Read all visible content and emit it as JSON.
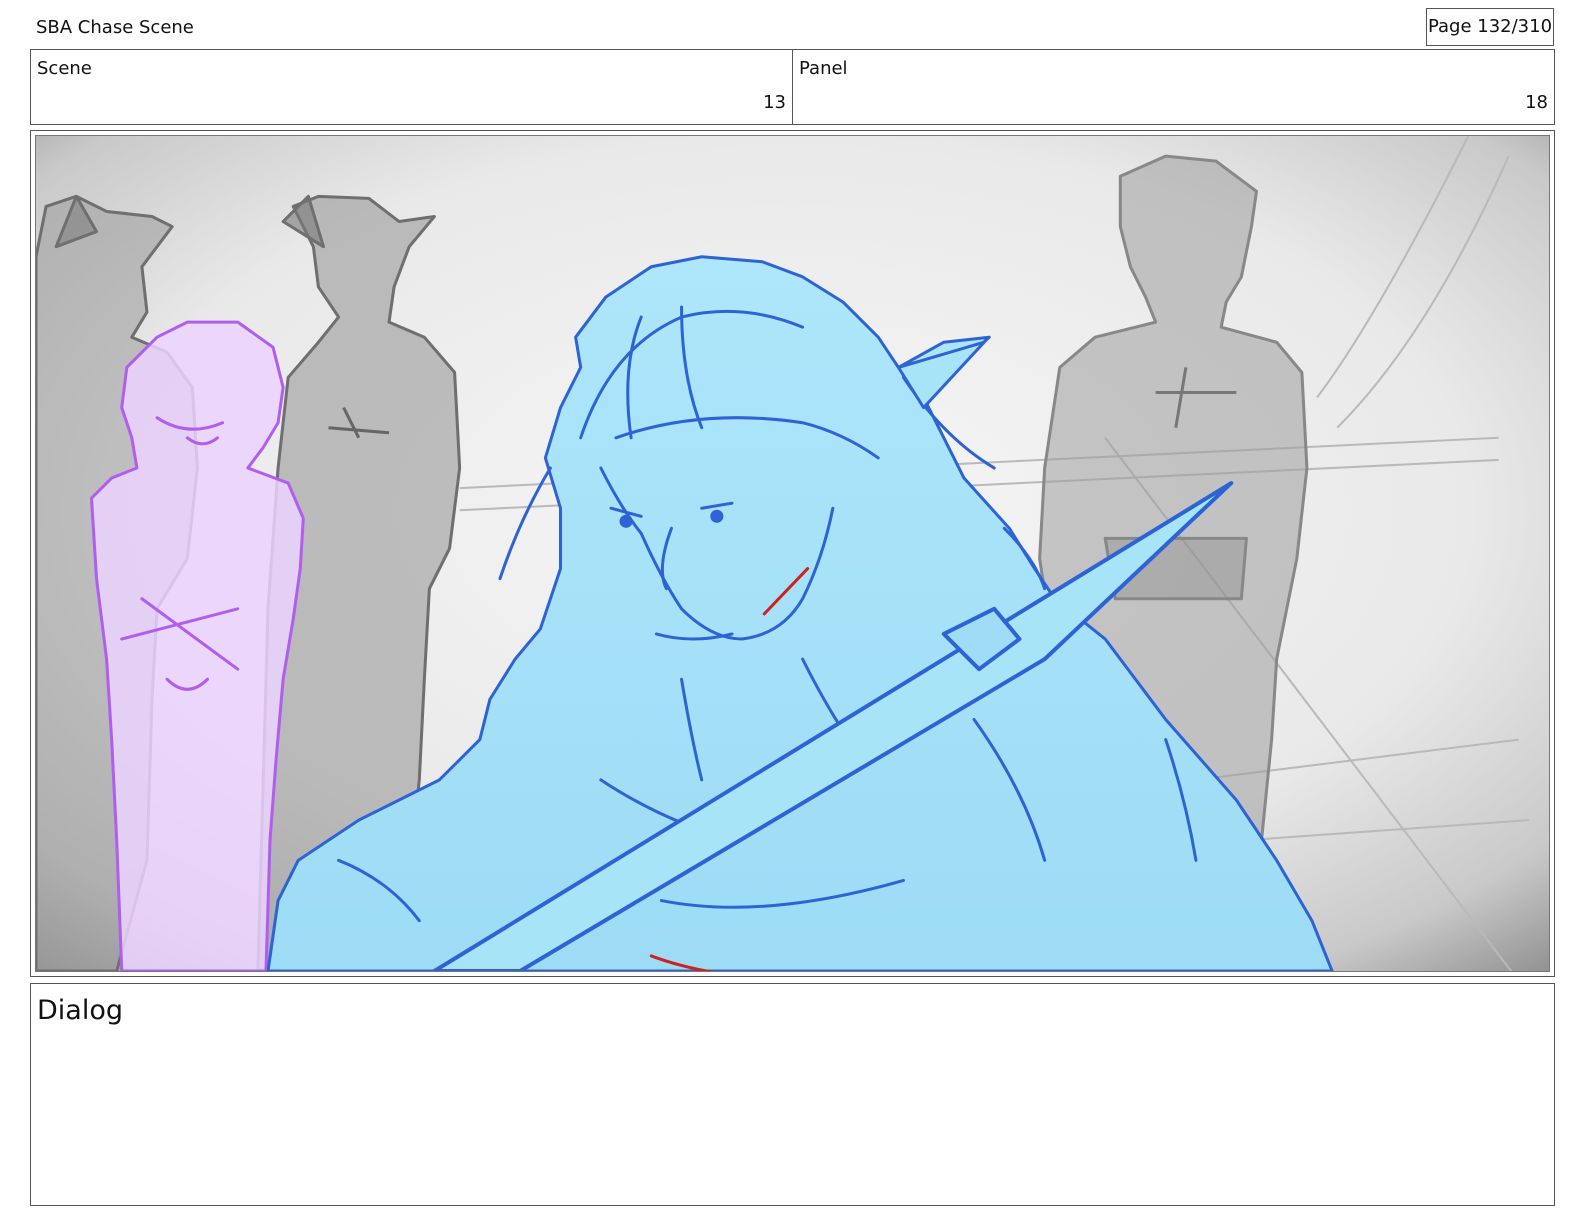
{
  "header": {
    "title": "SBA Chase Scene",
    "page": "Page 132/310"
  },
  "info": {
    "scene_label": "Scene",
    "scene_value": "13",
    "panel_label": "Panel",
    "panel_value": "18"
  },
  "dialog": {
    "label": "Dialog"
  },
  "colors": {
    "hero_fill": "#a8e4f8",
    "hero_line": "#2e63d6",
    "girl_fill": "#ecd4ff",
    "girl_line": "#b05ef0",
    "sketch_gray": "#8a8a8a",
    "scratch_red": "#d02020"
  }
}
